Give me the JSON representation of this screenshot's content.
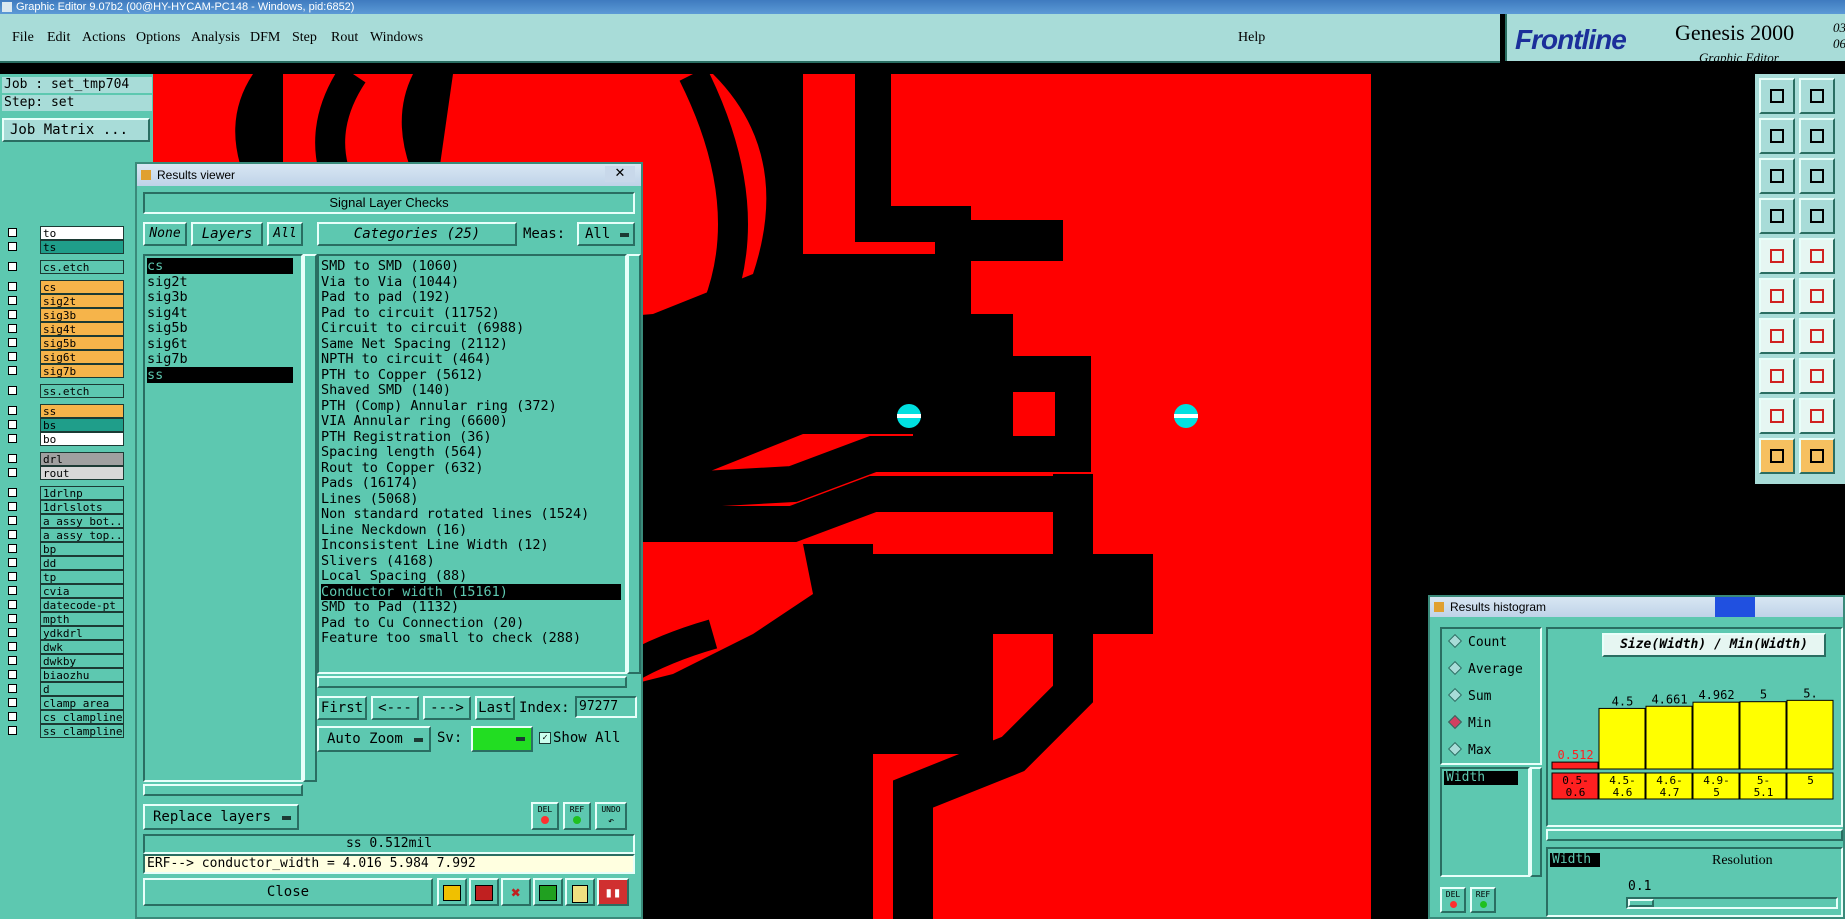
{
  "window": {
    "title": "Graphic Editor 9.07b2 (00@HY-HYCAM-PC148 - Windows, pid:6852)"
  },
  "menu": [
    "File",
    "Edit",
    "Actions",
    "Options",
    "Analysis",
    "DFM",
    "Step",
    "Rout",
    "Windows"
  ],
  "help_label": "Help",
  "logo": {
    "brand": "Frontline",
    "product": "Genesis 2000",
    "subtitle": "Graphic Editor",
    "date1": "03",
    "date2": "06"
  },
  "job": {
    "job_line": "Job : set_tmp704",
    "step_line": "Step: set",
    "matrix_button": "Job Matrix ..."
  },
  "layers": [
    {
      "name": "to",
      "color": "#ffffff"
    },
    {
      "name": "ts",
      "color": "#1f9e8a"
    },
    {
      "name": "cs.etch",
      "color": "#5dc8b0"
    },
    {
      "name": "cs",
      "color": "#f6b44a"
    },
    {
      "name": "sig2t",
      "color": "#f6b44a"
    },
    {
      "name": "sig3b",
      "color": "#f6b44a"
    },
    {
      "name": "sig4t",
      "color": "#f6b44a"
    },
    {
      "name": "sig5b",
      "color": "#f6b44a"
    },
    {
      "name": "sig6t",
      "color": "#f6b44a"
    },
    {
      "name": "sig7b",
      "color": "#f6b44a"
    },
    {
      "name": "ss.etch",
      "color": "#5dc8b0"
    },
    {
      "name": "ss",
      "color": "#f6b44a"
    },
    {
      "name": "bs",
      "color": "#1f9e8a"
    },
    {
      "name": "bo",
      "color": "#ffffff"
    },
    {
      "name": "drl",
      "color": "#a0a0a0"
    },
    {
      "name": "rout",
      "color": "#d8d8d8"
    },
    {
      "name": "1drlnp",
      "color": "#5dc8b0"
    },
    {
      "name": "1drlslots",
      "color": "#5dc8b0"
    },
    {
      "name": "a_assy_bot...",
      "color": "#5dc8b0"
    },
    {
      "name": "a_assy_top...",
      "color": "#5dc8b0"
    },
    {
      "name": "bp",
      "color": "#5dc8b0"
    },
    {
      "name": "dd",
      "color": "#5dc8b0"
    },
    {
      "name": "tp",
      "color": "#5dc8b0"
    },
    {
      "name": "cvia",
      "color": "#5dc8b0"
    },
    {
      "name": "datecode-pt",
      "color": "#5dc8b0"
    },
    {
      "name": "mpth",
      "color": "#5dc8b0"
    },
    {
      "name": "ydkdrl",
      "color": "#5dc8b0"
    },
    {
      "name": "dwk",
      "color": "#5dc8b0"
    },
    {
      "name": "dwkby",
      "color": "#5dc8b0"
    },
    {
      "name": "biaozhu",
      "color": "#5dc8b0"
    },
    {
      "name": "d",
      "color": "#5dc8b0"
    },
    {
      "name": "clamp_area",
      "color": "#5dc8b0"
    },
    {
      "name": "cs_clampline",
      "color": "#5dc8b0"
    },
    {
      "name": "ss_clampline",
      "color": "#5dc8b0"
    }
  ],
  "results_viewer": {
    "title": "Results viewer",
    "header": "Signal Layer Checks",
    "none_btn": "None",
    "layers_btn": "Layers",
    "all_btn": "All",
    "categories_btn": "Categories (25)",
    "meas_label": "Meas:",
    "meas_value": "All",
    "layer_list": [
      "cs",
      "sig2t",
      "sig3b",
      "sig4t",
      "sig5b",
      "sig6t",
      "sig7b",
      "ss"
    ],
    "categories": [
      "SMD to SMD (1060)",
      "Via to Via (1044)",
      "Pad to pad (192)",
      "Pad to circuit (11752)",
      "Circuit to circuit (6988)",
      "Same Net Spacing (2112)",
      "NPTH to circuit (464)",
      "PTH to Copper (5612)",
      "Shaved SMD (140)",
      "PTH (Comp) Annular ring (372)",
      "VIA Annular ring (6600)",
      "PTH Registration (36)",
      "Spacing length (564)",
      "Rout to Copper (632)",
      "Pads (16174)",
      "Lines (5068)",
      "Non standard rotated lines (1524)",
      "Line Neckdown (16)",
      "Inconsistent Line Width (12)",
      "Slivers (4168)",
      "Local Spacing (88)",
      "Conductor width (15161)",
      "SMD to Pad (1132)",
      "Pad to Cu Connection (20)",
      "Feature too small to check (288)"
    ],
    "selected_category": "Conductor width (15161)",
    "first_btn": "First",
    "prev_btn": "<---",
    "next_btn": "--->",
    "last_btn": "Last",
    "index_label": "Index:",
    "index_value": "97277",
    "autozoom_btn": "Auto Zoom",
    "sv_label": "Sv:",
    "show_all_label": "Show All",
    "replace_btn": "Replace layers",
    "del_label": "DEL",
    "ref_label": "REF",
    "undo_label": "UNDO",
    "status": "ss 0.512mil",
    "erf_line": "ERF--> conductor_width = 4.016 5.984 7.992",
    "close_btn": "Close"
  },
  "histogram": {
    "title": "Results histogram",
    "header": "Size(Width) / Min(Width)",
    "modes": [
      "Count",
      "Average",
      "Sum",
      "Min",
      "Max"
    ],
    "selected_mode": "Min",
    "attr_list": [
      "Width"
    ],
    "del_label": "DEL",
    "ref_label": "REF",
    "field_label": "Width",
    "resolution_label": "Resolution",
    "resolution_value": "0.1",
    "bars": [
      {
        "label": "0.512",
        "range_top": "0.5-",
        "range_bot": "0.6",
        "value": 0.512,
        "color": "#ff2020"
      },
      {
        "label": "4.5",
        "range_top": "4.5-",
        "range_bot": "4.6",
        "value": 4.5,
        "color": "#ffff00"
      },
      {
        "label": "4.661",
        "range_top": "4.6-",
        "range_bot": "4.7",
        "value": 4.661,
        "color": "#ffff00"
      },
      {
        "label": "4.962",
        "range_top": "4.9-",
        "range_bot": "5",
        "value": 4.962,
        "color": "#ffff00"
      },
      {
        "label": "5",
        "range_top": "5-",
        "range_bot": "5.1",
        "value": 5,
        "color": "#ffff00"
      },
      {
        "label": "5.",
        "range_top": "5",
        "range_bot": "",
        "value": 5.1,
        "color": "#ffff00"
      }
    ]
  }
}
